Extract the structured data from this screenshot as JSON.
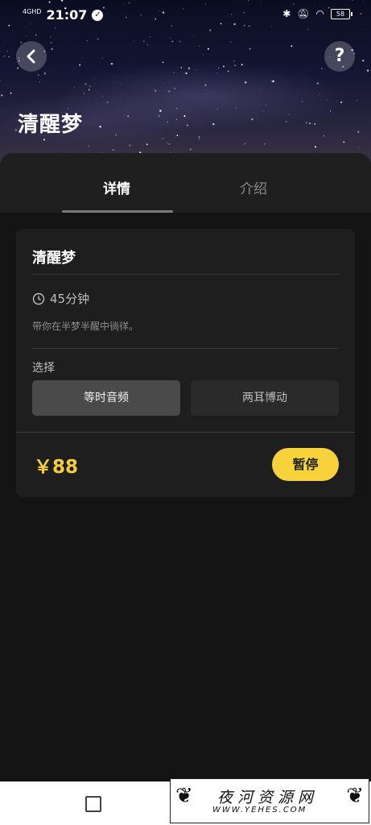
{
  "status_bar": {
    "signal": "4GHD",
    "time": "21:07",
    "battery": "58"
  },
  "header": {
    "title": "清醒梦",
    "back_icon": "chevron-left-icon",
    "help_label": "?"
  },
  "tabs": [
    {
      "label": "详情",
      "active": true
    },
    {
      "label": "介绍",
      "active": false
    }
  ],
  "card": {
    "title": "清醒梦",
    "duration": "45分钟",
    "description": "带你在半梦半醒中徜徉。",
    "select_label": "选择",
    "options": [
      {
        "label": "等时音频",
        "selected": true
      },
      {
        "label": "两耳博动",
        "selected": false
      }
    ],
    "price": "￥88",
    "action_label": "暂停"
  },
  "watermark": {
    "main": "夜河资源网",
    "sub": "WWW.YEHES.COM"
  },
  "colors": {
    "accent": "#f7d23a",
    "price": "#f6cf3a",
    "background": "#141414"
  }
}
